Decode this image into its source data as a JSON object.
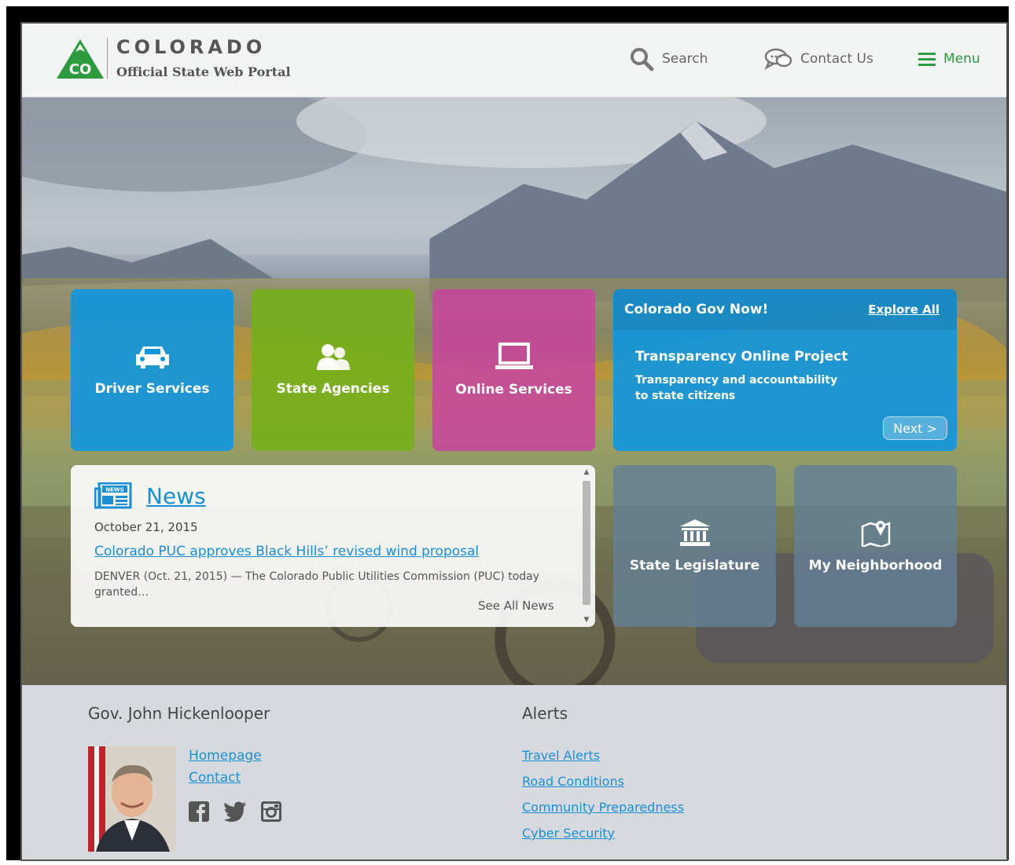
{
  "header": {
    "logo_badge": "CO",
    "logo_title": "COLORADO",
    "logo_subtitle": "Official State Web Portal",
    "search_label": "Search",
    "contact_label": "Contact Us",
    "menu_label": "Menu"
  },
  "tiles": {
    "driver": "Driver Services",
    "agencies": "State Agencies",
    "online": "Online Services",
    "legislature": "State Legislature",
    "neighborhood": "My Neighborhood"
  },
  "gov_now": {
    "title": "Colorado Gov Now!",
    "explore": "Explore All",
    "headline": "Transparency Online Project",
    "text": "Transparency and accountability to state citizens",
    "next": "Next >"
  },
  "news": {
    "icon_text": "NEWS",
    "title": "News",
    "date": "October 21, 2015",
    "headline": "Colorado PUC approves Black Hills’ revised wind proposal",
    "excerpt": "DENVER (Oct. 21, 2015) — The Colorado Public Utilities Commission (PUC) today granted…",
    "see_all": "See All News"
  },
  "footer": {
    "governor_title": "Gov. John Hickenlooper",
    "links": {
      "homepage": "Homepage",
      "contact": "Contact"
    },
    "alerts_title": "Alerts",
    "alerts": [
      "Travel Alerts",
      "Road Conditions",
      "Community Preparedness",
      "Cyber Security"
    ]
  },
  "colors": {
    "brand_green": "#2e9b3f",
    "link_blue": "#1a8fd6",
    "tile_blue": "#1496dc",
    "tile_green": "#76af1c",
    "tile_magenta": "#c7489b",
    "tile_slate": "#64809a"
  },
  "icons": [
    "search-icon",
    "chat-icon",
    "hamburger-icon",
    "car-icon",
    "people-icon",
    "laptop-icon",
    "newspaper-icon",
    "capitol-icon",
    "map-pin-icon",
    "facebook-icon",
    "twitter-icon",
    "instagram-icon"
  ]
}
